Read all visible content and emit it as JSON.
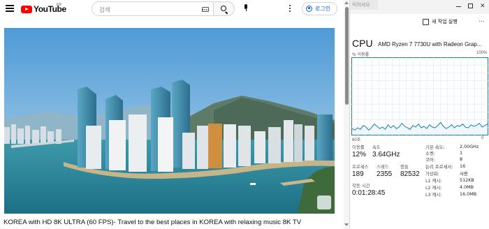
{
  "youtube": {
    "logo_text": "YouTube",
    "logo_region": "KR",
    "search_placeholder": "검색",
    "login_label": "로그인",
    "video_title": "KOREA with HD 8K ULTRA (60 FPS)- Travel to the best places in KOREA with relaxing music 8K TV",
    "accent_color": "#ff0000",
    "link_color": "#065fd4"
  },
  "task_manager": {
    "tab_hint": "릭하세요",
    "run_new_task_label": "새 작업 실행",
    "cpu_title": "CPU",
    "cpu_model": "AMD Ryzen 7 7730U with Radeon Grap...",
    "utilization_label": "% 이용률",
    "utilization_max": "100%",
    "graph_time_label": "60초",
    "graph_min_label": "0",
    "graph_color": "#117dbb",
    "stats": [
      {
        "label": "이용률",
        "value": "12%"
      },
      {
        "label": "속도",
        "value": "3.64GHz"
      },
      {
        "label": "프로세스",
        "value": "189"
      },
      {
        "label": "스레드",
        "value": "2355"
      },
      {
        "label": "핸들",
        "value": "82532"
      },
      {
        "label": "작동 시간",
        "value": "0:01:28:45"
      }
    ],
    "specs": [
      {
        "key": "기본 속도:",
        "value": "2.00GHz"
      },
      {
        "key": "소켓:",
        "value": "1"
      },
      {
        "key": "코어:",
        "value": "8"
      },
      {
        "key": "논리 프로세서:",
        "value": "16"
      },
      {
        "key": "가상화:",
        "value": "사용"
      },
      {
        "key": "L1 캐시:",
        "value": "512KB"
      },
      {
        "key": "L2 캐시:",
        "value": "4.0MB"
      },
      {
        "key": "L3 캐시:",
        "value": "16.0MB"
      }
    ],
    "cpu_usage_history_percent": [
      8,
      6,
      9,
      7,
      12,
      10,
      6,
      9,
      14,
      11,
      8,
      10,
      7,
      13,
      9,
      12,
      8,
      10,
      15,
      11,
      9,
      7,
      12,
      10,
      14,
      9,
      11,
      8,
      13,
      10,
      9,
      12,
      16,
      11,
      8,
      10,
      13,
      9,
      12,
      11,
      14,
      10,
      9,
      13,
      11,
      12,
      15,
      10,
      12,
      14
    ]
  }
}
